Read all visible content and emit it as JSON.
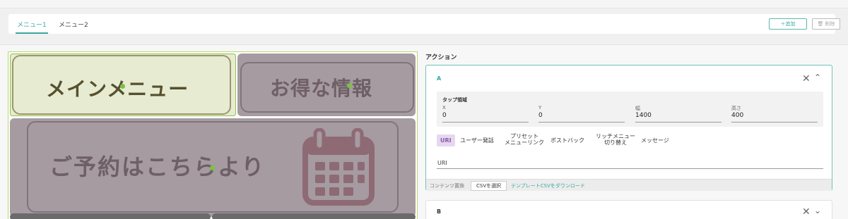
{
  "menu_tabs": [
    "メニュー1",
    "メニュー2"
  ],
  "toolbar": {
    "add_label": "＋追加",
    "delete_label": "🗑 削除"
  },
  "canvas": {
    "tiles": {
      "main": "メインメニュー",
      "info": "お得な情報",
      "reserve": "ご予約はこちらより"
    }
  },
  "actions": {
    "title": "アクション",
    "card_a": {
      "title": "A",
      "tap_area": {
        "title": "タップ領域",
        "fields": [
          {
            "label": "X",
            "value": "0"
          },
          {
            "label": "Y",
            "value": "0"
          },
          {
            "label": "幅",
            "value": "1400"
          },
          {
            "label": "高さ",
            "value": "400"
          }
        ]
      },
      "action_types": [
        "URI",
        "ユーザー発話",
        "プリセット\nメニューリンク",
        "ポストバック",
        "リッチメニュー\n切り替え",
        "メッセージ"
      ],
      "selected_action": "URI",
      "uri_field_label": "URI",
      "footer": {
        "label": "コンテンツ置換",
        "csv_button": "CSVを選択",
        "template_link": "テンプレートCSVをダウンロード"
      }
    },
    "card_b": {
      "title": "B"
    }
  },
  "colors": {
    "accent": "#3aa8a0",
    "selected_action_bg": "#e6d7f0",
    "canvas_outline": "#b6d96a"
  }
}
